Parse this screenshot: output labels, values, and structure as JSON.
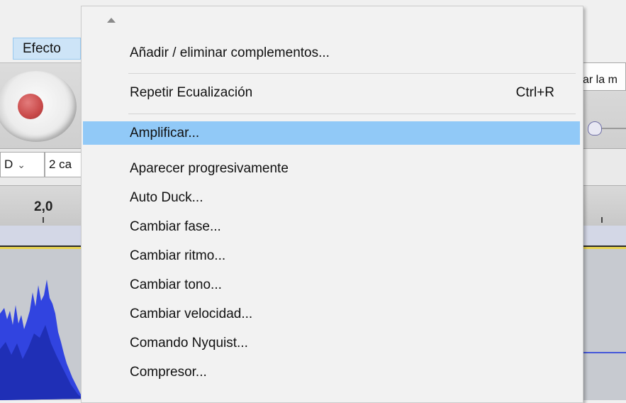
{
  "menubar": {
    "active_menu": "Efecto"
  },
  "toolbar": {
    "meter_text": "ar la m"
  },
  "device_bar": {
    "device": "D",
    "channels": "2 ca"
  },
  "timeline": {
    "tick_label": "2,0"
  },
  "menu": {
    "items": [
      {
        "label": "Añadir / eliminar complementos...",
        "shortcut": ""
      },
      {
        "label": "Repetir Ecualización",
        "shortcut": "Ctrl+R"
      },
      {
        "label": "Amplificar...",
        "shortcut": "",
        "highlighted": true
      },
      {
        "label": "Aparecer progresivamente",
        "shortcut": ""
      },
      {
        "label": "Auto Duck...",
        "shortcut": ""
      },
      {
        "label": "Cambiar fase...",
        "shortcut": ""
      },
      {
        "label": "Cambiar ritmo...",
        "shortcut": ""
      },
      {
        "label": "Cambiar tono...",
        "shortcut": ""
      },
      {
        "label": "Cambiar velocidad...",
        "shortcut": ""
      },
      {
        "label": "Comando Nyquist...",
        "shortcut": ""
      },
      {
        "label": "Compresor...",
        "shortcut": ""
      }
    ]
  },
  "colors": {
    "highlight": "#91c9f7",
    "waveform": "#3144e0",
    "record": "#c94a4a"
  }
}
